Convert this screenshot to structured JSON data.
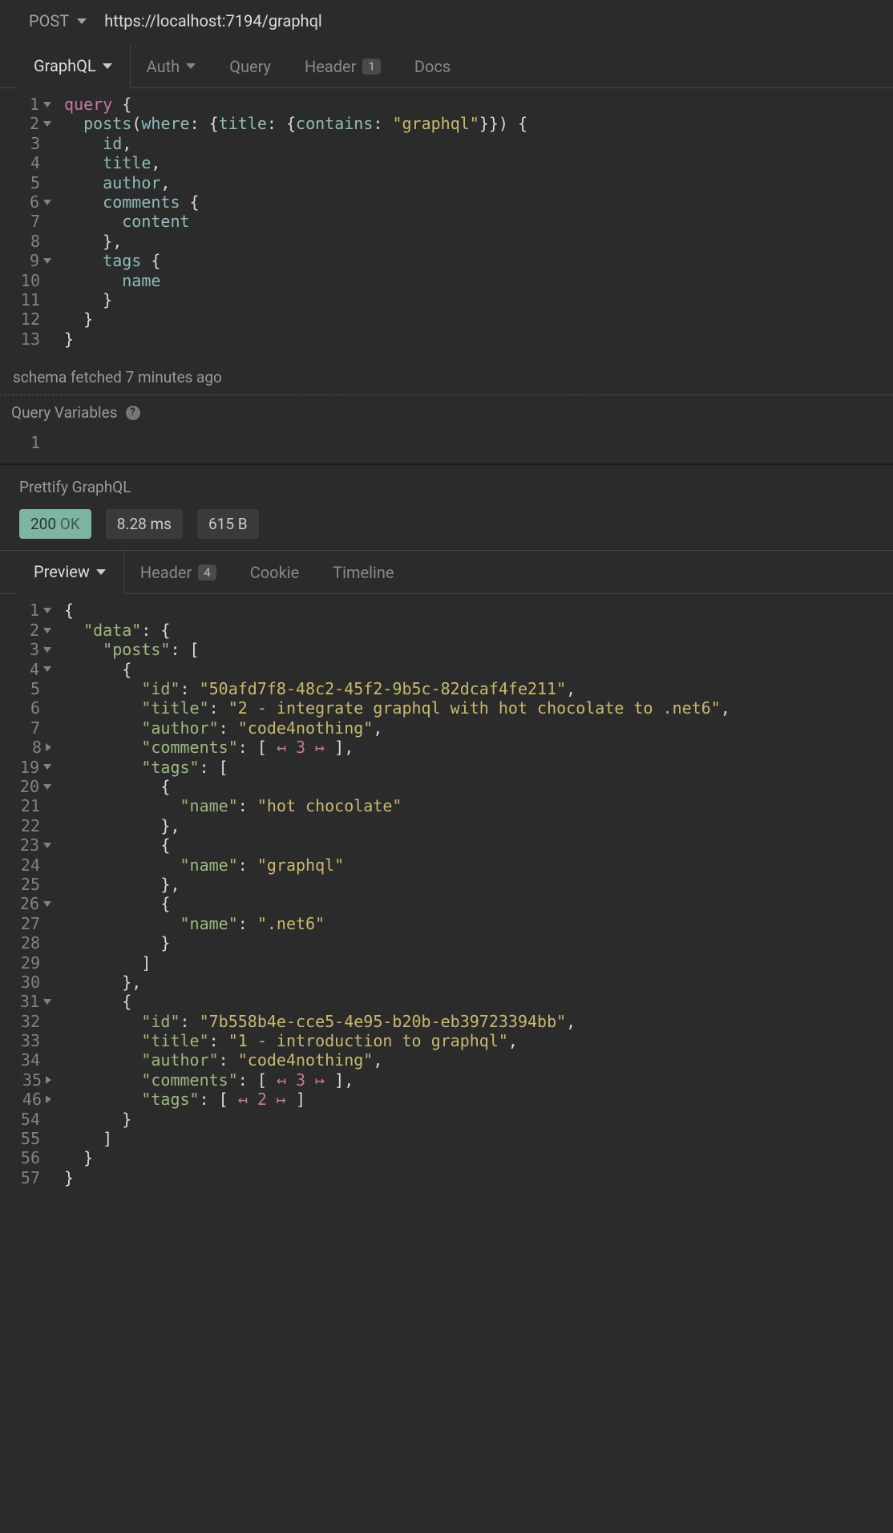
{
  "request": {
    "method": "POST",
    "url": "https://localhost:7194/graphql"
  },
  "request_tabs": {
    "active": "GraphQL",
    "items": [
      {
        "label": "GraphQL",
        "dropdown": true
      },
      {
        "label": "Auth",
        "dropdown": true
      },
      {
        "label": "Query"
      },
      {
        "label": "Header",
        "badge": "1"
      },
      {
        "label": "Docs"
      }
    ]
  },
  "query_editor": {
    "lines": [
      {
        "n": "1",
        "fold": "down",
        "html": "<span class='kw'>query</span> {"
      },
      {
        "n": "2",
        "fold": "down",
        "html": "  <span class='field'>posts</span>(<span class='field'>where</span>: {<span class='field'>title</span>: {<span class='field'>contains</span>: <span class='str'>\"graphql\"</span>}}) {"
      },
      {
        "n": "3",
        "html": "    <span class='field'>id</span>,"
      },
      {
        "n": "4",
        "html": "    <span class='field'>title</span>,"
      },
      {
        "n": "5",
        "html": "    <span class='field'>author</span>,"
      },
      {
        "n": "6",
        "fold": "down",
        "html": "    <span class='field'>comments</span> {"
      },
      {
        "n": "7",
        "html": "      <span class='field'>content</span>"
      },
      {
        "n": "8",
        "html": "    },"
      },
      {
        "n": "9",
        "fold": "down",
        "html": "    <span class='field'>tags</span> {"
      },
      {
        "n": "10",
        "html": "      <span class='field'>name</span>"
      },
      {
        "n": "11",
        "html": "    }"
      },
      {
        "n": "12",
        "html": "  }"
      },
      {
        "n": "13",
        "html": "}"
      }
    ]
  },
  "schema_status": "schema fetched 7 minutes ago",
  "query_variables_label": "Query Variables",
  "variables_editor": {
    "lines": [
      {
        "n": "1",
        "html": ""
      }
    ]
  },
  "prettify_label": "Prettify GraphQL",
  "response_status": {
    "code": "200",
    "text": "OK",
    "time": "8.28 ms",
    "size": "615 B"
  },
  "response_tabs": {
    "active": "Preview",
    "items": [
      {
        "label": "Preview",
        "dropdown": true
      },
      {
        "label": "Header",
        "badge": "4"
      },
      {
        "label": "Cookie"
      },
      {
        "label": "Timeline"
      }
    ]
  },
  "response_editor": {
    "lines": [
      {
        "n": "1",
        "fold": "down",
        "html": "{"
      },
      {
        "n": "2",
        "fold": "down",
        "html": "  <span class='jkey'>\"data\"</span>: {"
      },
      {
        "n": "3",
        "fold": "down",
        "html": "    <span class='jkey'>\"posts\"</span>: ["
      },
      {
        "n": "4",
        "fold": "down",
        "html": "      {"
      },
      {
        "n": "5",
        "html": "        <span class='jkey'>\"id\"</span>: <span class='jstr'>\"50afd7f8-48c2-45f2-9b5c-82dcaf4fe211\"</span>,"
      },
      {
        "n": "6",
        "html": "        <span class='jkey'>\"title\"</span>: <span class='jstr'>\"2 - integrate graphql with hot chocolate to .net6\"</span>,"
      },
      {
        "n": "7",
        "html": "        <span class='jkey'>\"author\"</span>: <span class='jstr'>\"code4nothing\"</span>,"
      },
      {
        "n": "8",
        "fold": "right",
        "html": "        <span class='jkey'>\"comments\"</span>: [ <span class='collapse'>↤ 3 ↦</span> ],"
      },
      {
        "n": "19",
        "fold": "down",
        "html": "        <span class='jkey'>\"tags\"</span>: ["
      },
      {
        "n": "20",
        "fold": "down",
        "html": "          {"
      },
      {
        "n": "21",
        "html": "            <span class='jkey'>\"name\"</span>: <span class='jstr'>\"hot chocolate\"</span>"
      },
      {
        "n": "22",
        "html": "          },"
      },
      {
        "n": "23",
        "fold": "down",
        "html": "          {"
      },
      {
        "n": "24",
        "html": "            <span class='jkey'>\"name\"</span>: <span class='jstr'>\"graphql\"</span>"
      },
      {
        "n": "25",
        "html": "          },"
      },
      {
        "n": "26",
        "fold": "down",
        "html": "          {"
      },
      {
        "n": "27",
        "html": "            <span class='jkey'>\"name\"</span>: <span class='jstr'>\".net6\"</span>"
      },
      {
        "n": "28",
        "html": "          }"
      },
      {
        "n": "29",
        "html": "        ]"
      },
      {
        "n": "30",
        "html": "      },"
      },
      {
        "n": "31",
        "fold": "down",
        "html": "      {"
      },
      {
        "n": "32",
        "html": "        <span class='jkey'>\"id\"</span>: <span class='jstr'>\"7b558b4e-cce5-4e95-b20b-eb39723394bb\"</span>,"
      },
      {
        "n": "33",
        "html": "        <span class='jkey'>\"title\"</span>: <span class='jstr'>\"1 - introduction to graphql\"</span>,"
      },
      {
        "n": "34",
        "html": "        <span class='jkey'>\"author\"</span>: <span class='jstr'>\"code4nothing\"</span>,"
      },
      {
        "n": "35",
        "fold": "right",
        "html": "        <span class='jkey'>\"comments\"</span>: [ <span class='collapse'>↤ 3 ↦</span> ],"
      },
      {
        "n": "46",
        "fold": "right",
        "html": "        <span class='jkey'>\"tags\"</span>: [ <span class='collapse'>↤ 2 ↦</span> ]"
      },
      {
        "n": "54",
        "html": "      }"
      },
      {
        "n": "55",
        "html": "    ]"
      },
      {
        "n": "56",
        "html": "  }"
      },
      {
        "n": "57",
        "html": "}"
      }
    ]
  }
}
